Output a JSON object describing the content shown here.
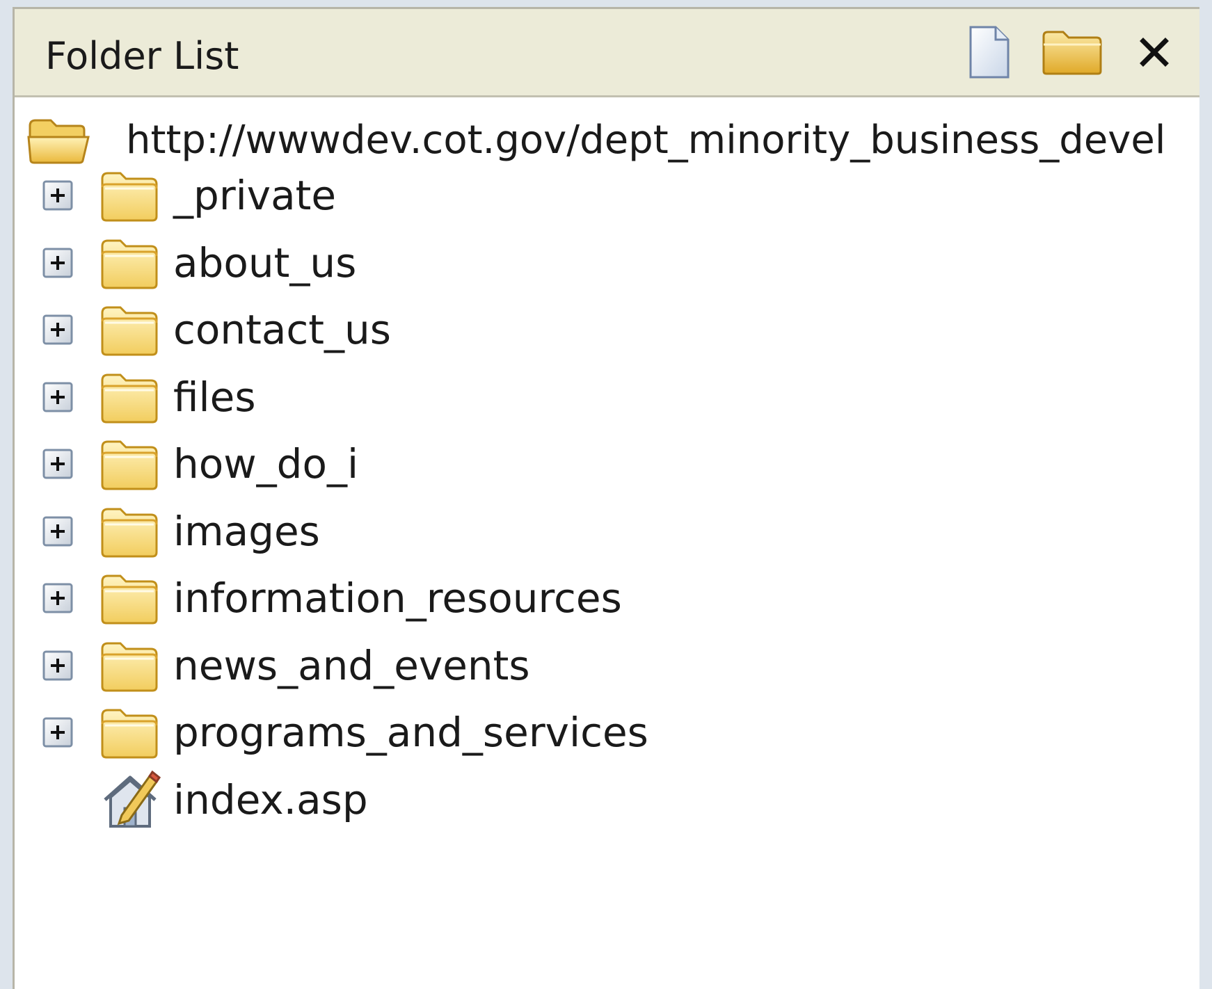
{
  "panel": {
    "title": "Folder List",
    "toolbar": {
      "new_page_icon": "new-page-icon",
      "new_folder_icon": "new-folder-icon",
      "close_icon": "close-icon"
    }
  },
  "tree": {
    "root": {
      "label": "http://wwwdev.cot.gov/dept_minority_business_devel",
      "icon": "open-folder-icon"
    },
    "items": [
      {
        "label": "_private",
        "type": "folder",
        "expanded": false
      },
      {
        "label": "about_us",
        "type": "folder",
        "expanded": false
      },
      {
        "label": "contact_us",
        "type": "folder",
        "expanded": false
      },
      {
        "label": "files",
        "type": "folder",
        "expanded": false
      },
      {
        "label": "how_do_i",
        "type": "folder",
        "expanded": false
      },
      {
        "label": "images",
        "type": "folder",
        "expanded": false
      },
      {
        "label": "information_resources",
        "type": "folder",
        "expanded": false
      },
      {
        "label": "news_and_events",
        "type": "folder",
        "expanded": false
      },
      {
        "label": "programs_and_services",
        "type": "folder",
        "expanded": false
      },
      {
        "label": "index.asp",
        "type": "file",
        "icon": "home-page-icon"
      }
    ]
  },
  "colors": {
    "header_bg": "#ecebd8",
    "folder_fill": "#f6d86e",
    "folder_edge": "#c9961e",
    "panel_bg": "#ffffff"
  }
}
